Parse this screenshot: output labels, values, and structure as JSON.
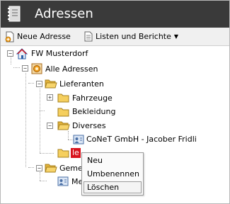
{
  "header": {
    "title": "Adressen",
    "icon": "address-book-icon"
  },
  "toolbar": {
    "new_address": "Neue Adresse",
    "lists_reports": "Listen und Berichte"
  },
  "tree": {
    "root": "FW Musterdorf",
    "all_addresses": "Alle Adressen",
    "suppliers": "Lieferanten",
    "vehicles": "Fahrzeuge",
    "clothing": "Bekleidung",
    "misc": "Diverses",
    "contact": "CoNeT GmbH - Jacober Fridli",
    "editing": "le",
    "group_partial": "Geme",
    "member_partial": "Me"
  },
  "context_menu": {
    "items": [
      "Neu",
      "Umbenennen",
      "Löschen"
    ],
    "highlighted": "Löschen"
  },
  "colors": {
    "header_bg": "#3a3a3a",
    "selection": "#d8121c",
    "folder": "#f2c94c"
  }
}
